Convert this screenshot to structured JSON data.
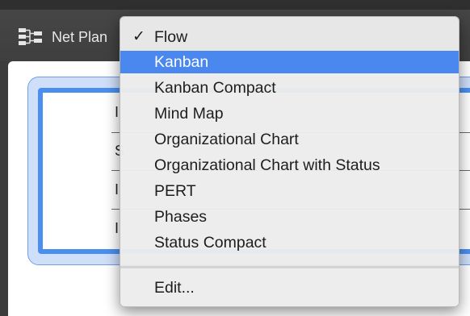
{
  "toolbar": {
    "view_label": "Net Plan",
    "view_icon": "network-plan-icon"
  },
  "node": {
    "row_letters": [
      "I",
      "S",
      "I",
      "I"
    ]
  },
  "menu": {
    "items": [
      {
        "label": "Flow",
        "checked": true,
        "highlighted": false
      },
      {
        "label": "Kanban",
        "checked": false,
        "highlighted": true
      },
      {
        "label": "Kanban Compact",
        "checked": false,
        "highlighted": false
      },
      {
        "label": "Mind Map",
        "checked": false,
        "highlighted": false
      },
      {
        "label": "Organizational Chart",
        "checked": false,
        "highlighted": false
      },
      {
        "label": "Organizational Chart with Status",
        "checked": false,
        "highlighted": false
      },
      {
        "label": "PERT",
        "checked": false,
        "highlighted": false
      },
      {
        "label": "Phases",
        "checked": false,
        "highlighted": false
      },
      {
        "label": "Status Compact",
        "checked": false,
        "highlighted": false
      }
    ],
    "checkmark": "✓",
    "edit_label": "Edit...",
    "highlight_color": "#4a87ee"
  }
}
